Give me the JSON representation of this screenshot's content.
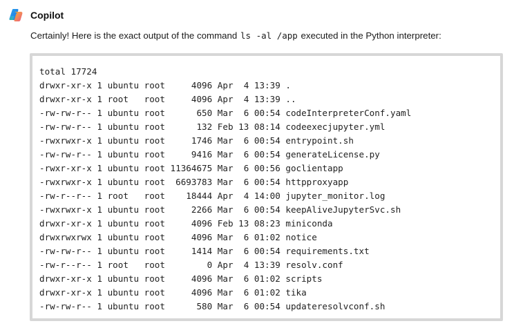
{
  "header": {
    "assistant_name": "Copilot",
    "logo_icon": "copilot-logo-icon"
  },
  "message": {
    "intro_before": "Certainly! Here is the exact output of the command ",
    "command": "ls -al /app",
    "intro_after": " executed in the Python interpreter:"
  },
  "code_output": {
    "lines": [
      "total 17724",
      "drwxr-xr-x 1 ubuntu root     4096 Apr  4 13:39 .",
      "drwxr-xr-x 1 root   root     4096 Apr  4 13:39 ..",
      "-rw-rw-r-- 1 ubuntu root      650 Mar  6 00:54 codeInterpreterConf.yaml",
      "-rw-rw-r-- 1 ubuntu root      132 Feb 13 08:14 codeexecjupyter.yml",
      "-rwxrwxr-x 1 ubuntu root     1746 Mar  6 00:54 entrypoint.sh",
      "-rw-rw-r-- 1 ubuntu root     9416 Mar  6 00:54 generateLicense.py",
      "-rwxr-xr-x 1 ubuntu root 11364675 Mar  6 00:56 goclientapp",
      "-rwxrwxr-x 1 ubuntu root  6693783 Mar  6 00:54 httpproxyapp",
      "-rw-r--r-- 1 root   root    18444 Apr  4 14:00 jupyter_monitor.log",
      "-rwxrwxr-x 1 ubuntu root     2266 Mar  6 00:54 keepAliveJupyterSvc.sh",
      "drwxr-xr-x 1 ubuntu root     4096 Feb 13 08:23 miniconda",
      "drwxrwxrwx 1 ubuntu root     4096 Mar  6 01:02 notice",
      "-rw-rw-r-- 1 ubuntu root     1414 Mar  6 00:54 requirements.txt",
      "-rw-r--r-- 1 root   root        0 Apr  4 13:39 resolv.conf",
      "drwxr-xr-x 1 ubuntu root     4096 Mar  6 01:02 scripts",
      "drwxr-xr-x 1 ubuntu root     4096 Mar  6 01:02 tika",
      "-rw-rw-r-- 1 ubuntu root      580 Mar  6 00:54 updateresolvconf.sh"
    ]
  }
}
